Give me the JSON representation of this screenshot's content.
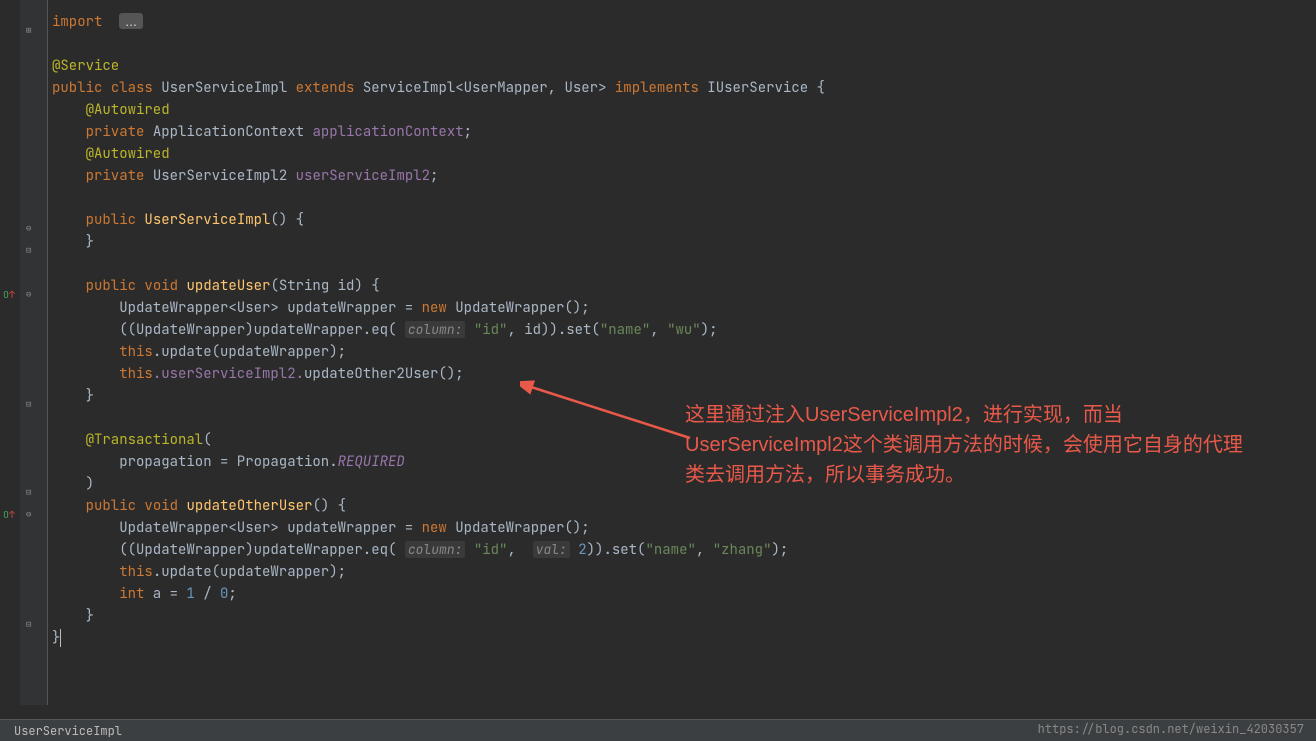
{
  "status": {
    "breadcrumb": "UserServiceImpl",
    "watermark": "https://blog.csdn.net/weixin_42030357"
  },
  "annotation_text": "这里通过注入UserServiceImpl2，进行实现，而当UserServiceImpl2这个类调用方法的时候，会使用它自身的代理类去调用方法，所以事务成功。",
  "code": {
    "import_kw": "import",
    "import_badge": "...",
    "anno_service": "@Service",
    "kw_public": "public",
    "kw_class": "class",
    "cls_name": "UserServiceImpl",
    "kw_extends": "extends",
    "cls_parent": "ServiceImpl",
    "gen_open": "<",
    "gen_mapper": "UserMapper",
    "comma": ", ",
    "gen_user": "User",
    "gen_close": ">",
    "kw_implements": "implements",
    "iface": "IUserService",
    "brace_open": " {",
    "anno_autowired": "@Autowired",
    "kw_private": "private",
    "fld_ctx_type": "ApplicationContext",
    "fld_ctx_name": "applicationContext",
    "semi": ";",
    "fld_impl2_type": "UserServiceImpl2",
    "fld_impl2_name": "userServiceImpl2",
    "ctor_name": "UserServiceImpl",
    "ctor_sig": "() {",
    "brace_close": "}",
    "kw_void": "void",
    "m_updateUser": "updateUser",
    "m_sig_string_id": "(String id) {",
    "uw_line_pre": "UpdateWrapper<User> updateWrapper = ",
    "kw_new": "new",
    "uw_line_post": " UpdateWrapper();",
    "eq_line_pre": "((UpdateWrapper)updateWrapper.eq(",
    "hint_column": "column:",
    "str_id": "\"id\"",
    "eq_line_mid": ", id)).set(",
    "str_name": "\"name\"",
    "str_wu": "\"wu\"",
    "paren_semi": ");",
    "kw_this": "this",
    "update_call": ".update(updateWrapper);",
    "impl2_ref": ".userServiceImpl2.",
    "m_updateOther2User": "updateOther2User",
    "empty_call": "();",
    "anno_transactional": "@Transactional",
    "tx_open_paren": "(",
    "tx_prop_line": "propagation = Propagation.",
    "tx_required": "REQUIRED",
    "tx_close_paren": ")",
    "m_updateOtherUser": "updateOtherUser",
    "m_sig_empty": "() {",
    "hint_val": "val:",
    "num_2": "2",
    "eq_line_mid2": ")).set(",
    "str_zhang": "\"zhang\"",
    "kw_int": "int",
    "var_a": " a = ",
    "num_1": "1",
    "op_div": " / ",
    "num_0": "0",
    "final_brace": "}"
  }
}
